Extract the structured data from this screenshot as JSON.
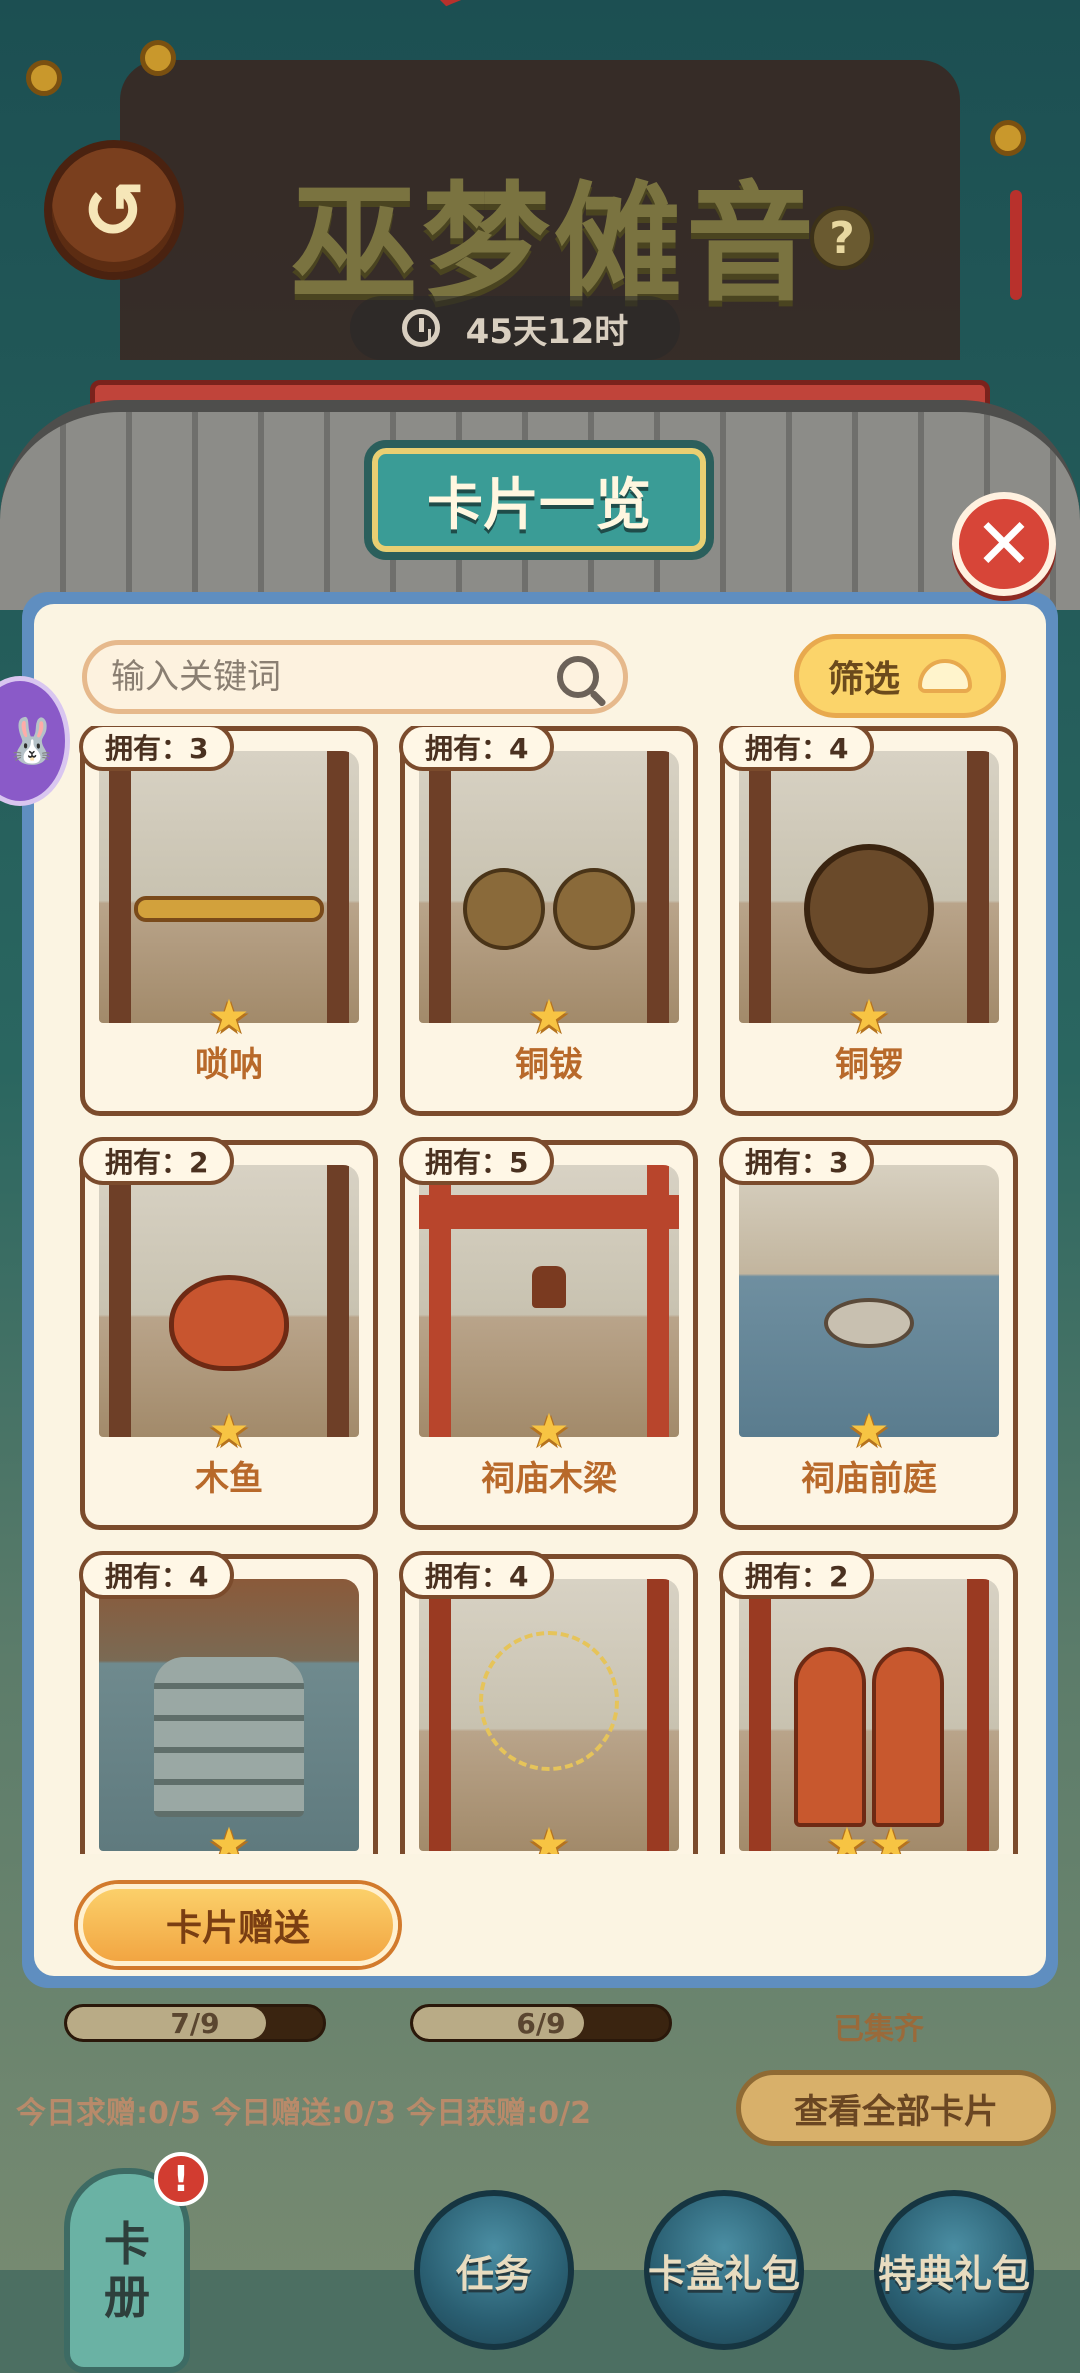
{
  "header": {
    "title": "巫梦傩音",
    "timer": "45天12时",
    "back_icon": "back-arrow-icon",
    "help_label": "?"
  },
  "panel": {
    "title": "卡片一览",
    "close_label": "✕"
  },
  "search": {
    "placeholder": "输入关键词",
    "value": ""
  },
  "filter": {
    "label": "筛选"
  },
  "cards": [
    {
      "owned": "拥有：3",
      "name": "唢呐",
      "icon": "suona-icon"
    },
    {
      "owned": "拥有：4",
      "name": "铜钹",
      "icon": "cymbals-icon"
    },
    {
      "owned": "拥有：4",
      "name": "铜锣",
      "icon": "gong-icon"
    },
    {
      "owned": "拥有：2",
      "name": "木鱼",
      "icon": "wooden-fish-icon"
    },
    {
      "owned": "拥有：5",
      "name": "祠庙木梁",
      "icon": "temple-beam-icon"
    },
    {
      "owned": "拥有：3",
      "name": "祠庙前庭",
      "icon": "temple-courtyard-icon"
    },
    {
      "owned": "拥有：4",
      "name": "",
      "icon": "stone-stairs-icon"
    },
    {
      "owned": "拥有：4",
      "name": "",
      "icon": "spider-web-icon"
    },
    {
      "owned": "拥有：2",
      "name": "",
      "icon": "temple-door-icon"
    }
  ],
  "gift_button": "卡片赠送",
  "progress": [
    {
      "label": "7/9",
      "value": 0.778
    },
    {
      "label": "6/9",
      "value": 0.667
    }
  ],
  "collected_label": "已集齐",
  "stats": "今日求赠:0/5 今日赠送:0/3 今日获赠:0/2",
  "view_all": "查看全部卡片",
  "bottom_nav": {
    "album_top": "卡",
    "album_bottom": "册",
    "alert": "!",
    "tasks": "任务",
    "card_box": "卡盒礼包",
    "special": "特典礼包"
  },
  "side_badge": "🐰",
  "colors": {
    "panel_border": "#5f8ec0",
    "card_border": "#7b4b2c",
    "card_name": "#b8692a",
    "accent_orange": "#f2a542",
    "close_red": "#d74538"
  }
}
